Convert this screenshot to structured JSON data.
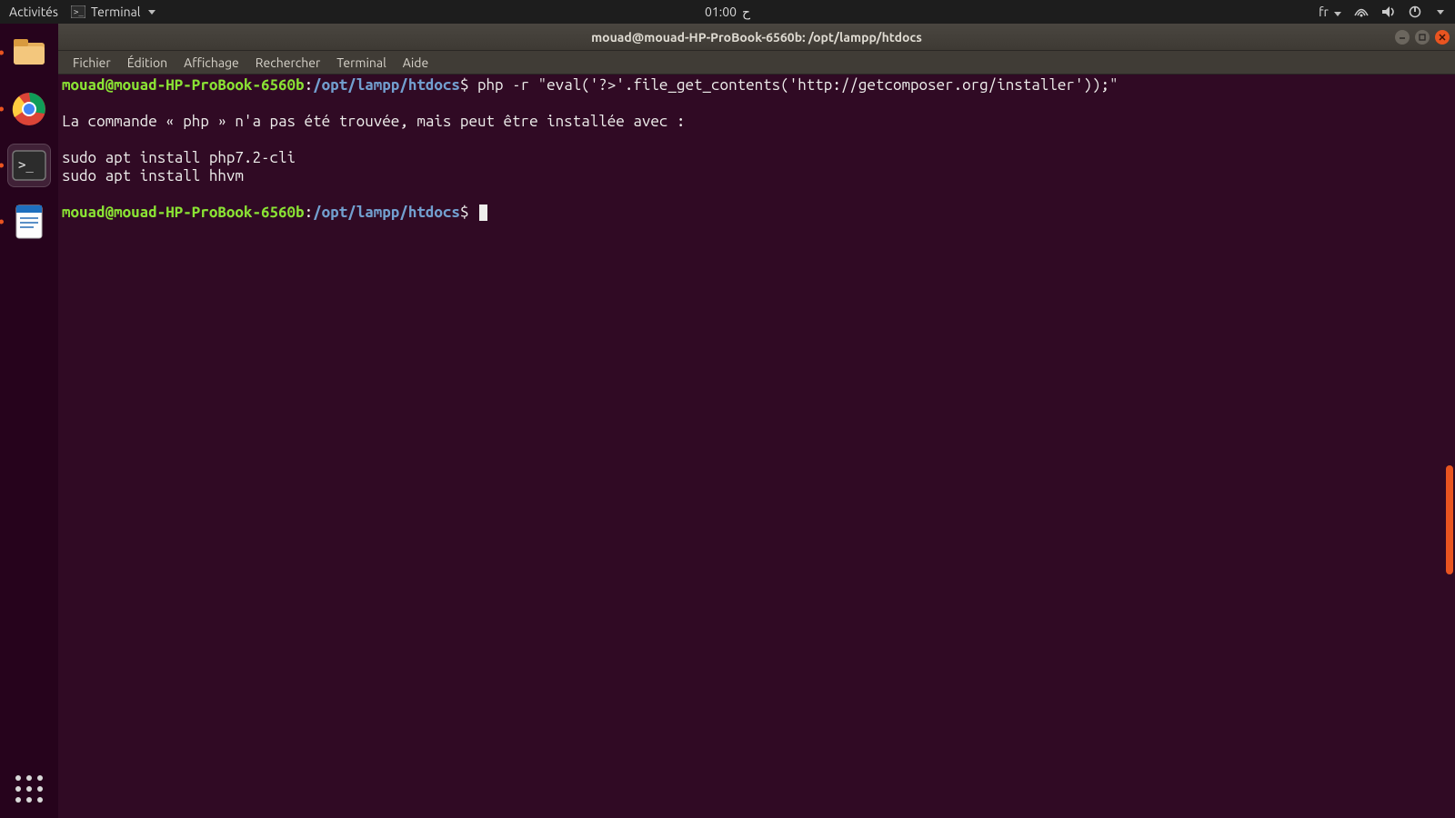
{
  "topbar": {
    "activities": "Activités",
    "app_name": "Terminal",
    "clock": "01:00",
    "lang": "fr"
  },
  "dock": {
    "items": [
      "files",
      "chrome",
      "terminal",
      "writer"
    ]
  },
  "window": {
    "title": "mouad@mouad-HP-ProBook-6560b: /opt/lampp/htdocs",
    "menus": [
      "Fichier",
      "Édition",
      "Affichage",
      "Rechercher",
      "Terminal",
      "Aide"
    ]
  },
  "terminal": {
    "prompt_user": "mouad@mouad-HP-ProBook-6560b",
    "prompt_sep": ":",
    "prompt_path": "/opt/lampp/htdocs",
    "prompt_symbol": "$",
    "lines": [
      {
        "type": "cmd",
        "text": "php -r \"eval('?>'.file_get_contents('http://getcomposer.org/installer'));\""
      },
      {
        "type": "blank"
      },
      {
        "type": "out",
        "text": "La commande « php » n'a pas été trouvée, mais peut être installée avec :"
      },
      {
        "type": "blank"
      },
      {
        "type": "out",
        "text": "sudo apt install php7.2-cli"
      },
      {
        "type": "out",
        "text": "sudo apt install hhvm"
      },
      {
        "type": "blank"
      },
      {
        "type": "prompt_cursor"
      }
    ]
  }
}
